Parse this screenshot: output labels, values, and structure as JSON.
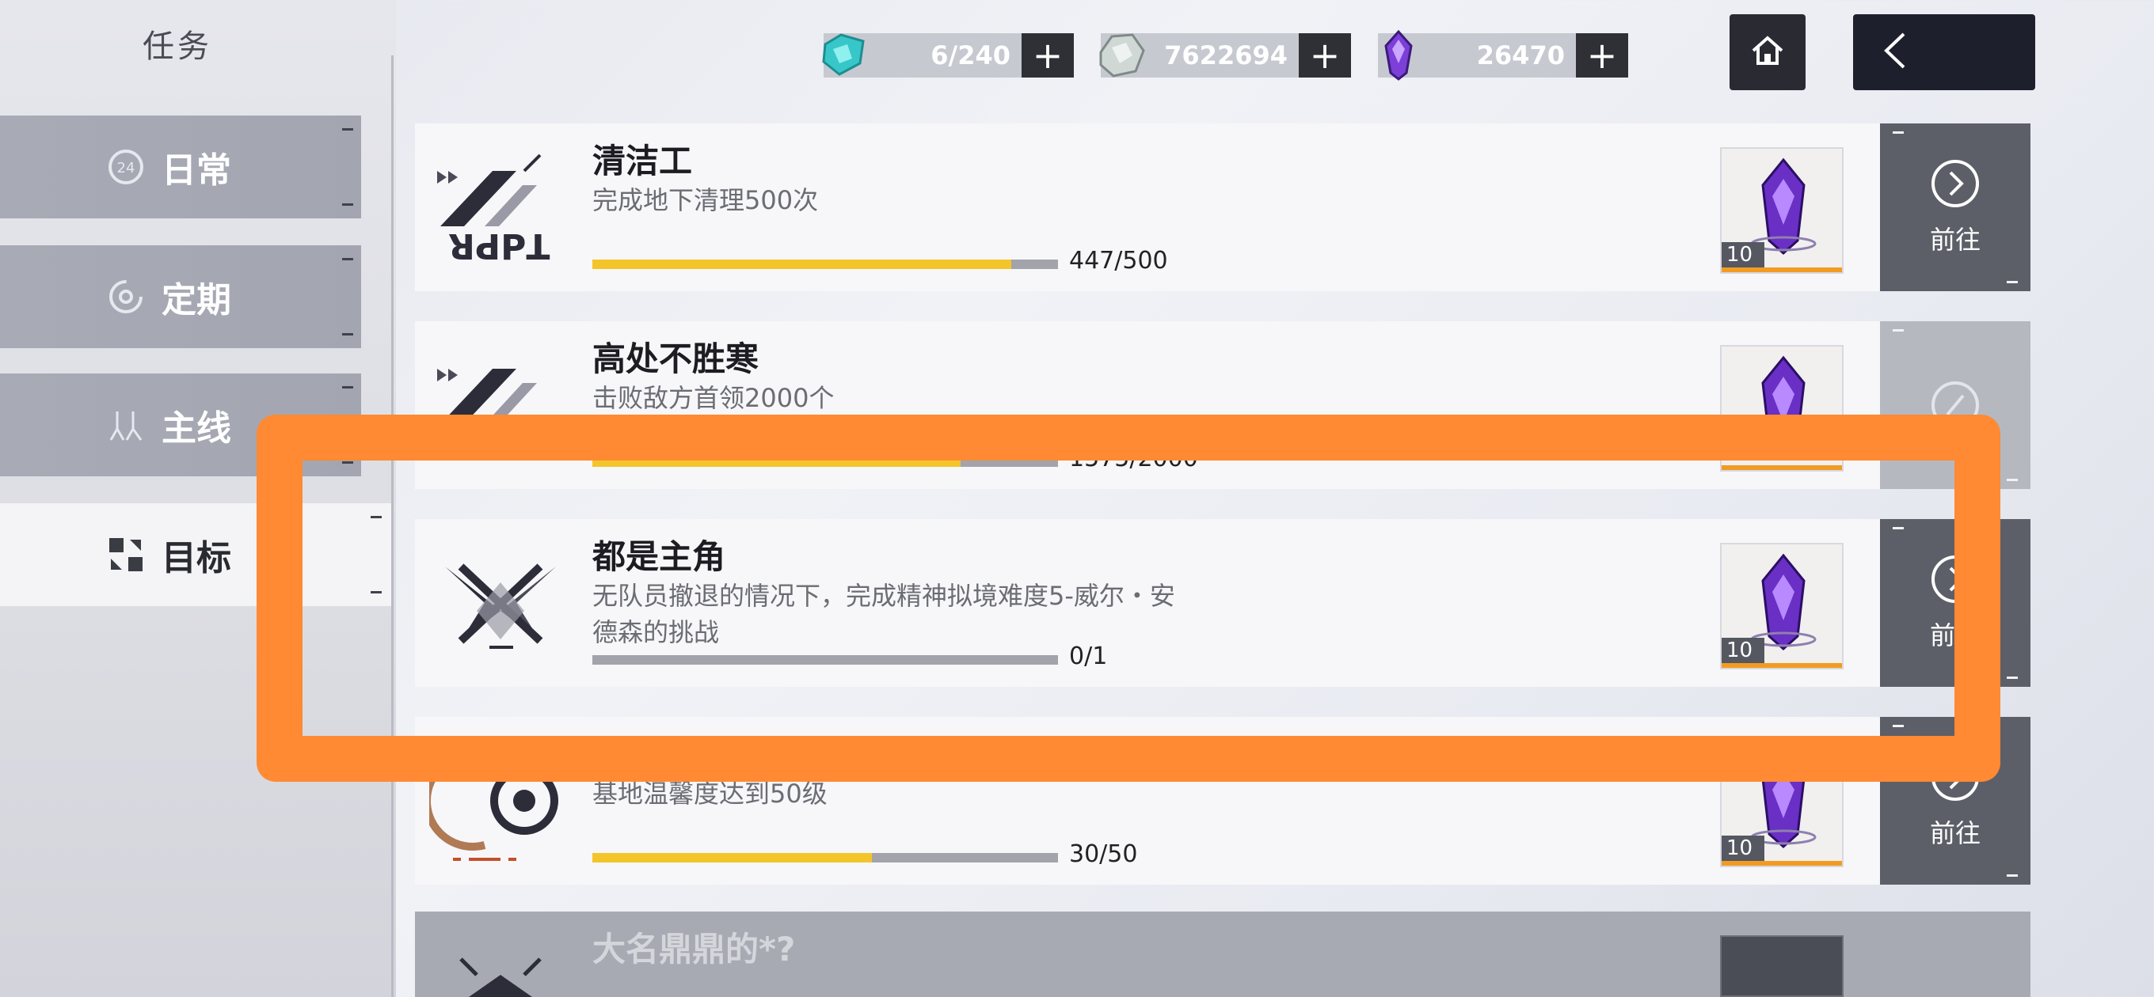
{
  "page": {
    "title": "任务"
  },
  "nav": {
    "items": [
      {
        "label": "日常",
        "icon": "daily-24-icon",
        "active": false
      },
      {
        "label": "定期",
        "icon": "cycle-icon",
        "active": false
      },
      {
        "label": "主线",
        "icon": "main-story-icon",
        "active": false
      },
      {
        "label": "目标",
        "icon": "target-icon",
        "active": true
      }
    ]
  },
  "currencies": [
    {
      "name": "stamina",
      "value": "6/240",
      "icon": "teal-crystal-icon",
      "color": "#38c7c9"
    },
    {
      "name": "coins",
      "value": "7622694",
      "icon": "silver-ore-icon",
      "color": "#b9c6c2"
    },
    {
      "name": "premium",
      "value": "26470",
      "icon": "purple-crystal-icon",
      "color": "#7c3fd8"
    }
  ],
  "quests": [
    {
      "title": "清洁工",
      "desc": "完成地下清理500次",
      "progress": "447/500",
      "fraction": 0.894,
      "reward_qty": "10",
      "action": "前往",
      "thumb": "agent-logo-icon",
      "enabled": true
    },
    {
      "title": "高处不胜寒",
      "desc": "击败敌方首领2000个",
      "progress": "1575/2000",
      "fraction": 0.7875,
      "reward_qty": "10",
      "action": "",
      "thumb": "agent-logo-icon",
      "enabled": false
    },
    {
      "title": "都是主角",
      "desc": "无队员撤退的情况下，完成精神拟境难度5-威尔・安德森的挑战",
      "progress": "0/1",
      "fraction": 0,
      "reward_qty": "10",
      "action": "前往",
      "thumb": "cross-emblem-icon",
      "enabled": true
    },
    {
      "title": "",
      "desc": "基地温馨度达到50级",
      "progress": "30/50",
      "fraction": 0.6,
      "reward_qty": "10",
      "action": "前往",
      "thumb": "ring-emblem-icon",
      "enabled": true
    },
    {
      "title": "大名鼎鼎的*?",
      "desc": "",
      "progress": "",
      "fraction": 0,
      "reward_qty": "",
      "action": "",
      "thumb": "agent-logo-icon",
      "enabled": false
    }
  ],
  "highlight": {
    "color": "#ff8a33"
  }
}
